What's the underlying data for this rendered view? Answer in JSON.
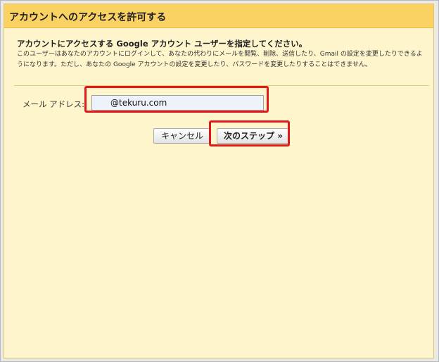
{
  "dialog": {
    "title": "アカウントへのアクセスを許可する",
    "heading": "アカウントにアクセスする Google アカウント ユーザーを指定してください。",
    "description": "このユーザーはあなたのアカウントにログインして、あなたの代わりにメールを閲覧、削除、送信したり、Gmail の設定を変更したりできるようになります。ただし、あなたの Google アカウントの設定を変更したり、パスワードを変更したりすることはできません。"
  },
  "form": {
    "email_label": "メール アドレス:",
    "email_value": "@tekuru.com"
  },
  "buttons": {
    "cancel_label": "キャンセル",
    "next_label": "次のステップ »"
  },
  "colors": {
    "titlebar": "#fad163",
    "background": "#fff5cc",
    "highlight": "#e01a1a"
  }
}
